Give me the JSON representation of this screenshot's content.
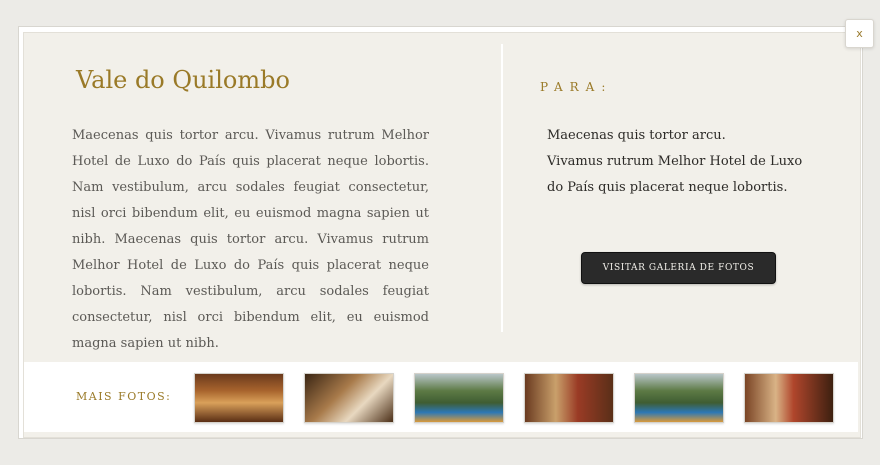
{
  "modal": {
    "close_label": "x",
    "title": "Vale do Quilombo",
    "description": "Maecenas quis tortor arcu. Vivamus rutrum Melhor Hotel de Luxo do País quis placerat neque lobortis. Nam vestibulum, arcu sodales feugiat consectetur, nisl orci bibendum elit, eu euismod magna sapien ut nibh. Maecenas quis tortor arcu. Vivamus rutrum Melhor Hotel de Luxo do País quis placerat neque lobortis. Nam vestibulum, arcu sodales feugiat consectetur, nisl orci bibendum elit, eu euismod magna sapien ut nibh."
  },
  "destination": {
    "label": "PARA:",
    "lines": [
      "Maecenas quis tortor arcu.",
      "Vivamus rutrum Melhor Hotel de Luxo",
      "do País quis placerat neque lobortis."
    ],
    "gallery_button": "VISITAR GALERIA DE FOTOS"
  },
  "more_photos": {
    "label": "MAIS FOTOS:",
    "thumbnails": [
      {
        "name": "lounge-thumbnail"
      },
      {
        "name": "room-thumbnail"
      },
      {
        "name": "pool-thumbnail"
      },
      {
        "name": "suite-thumbnail"
      },
      {
        "name": "pool-thumbnail"
      },
      {
        "name": "suite-thumbnail"
      }
    ]
  },
  "colors": {
    "accent_gold": "#9a7a28",
    "button_dark": "#2a2a2a",
    "panel_bg": "#f2f0ea"
  }
}
